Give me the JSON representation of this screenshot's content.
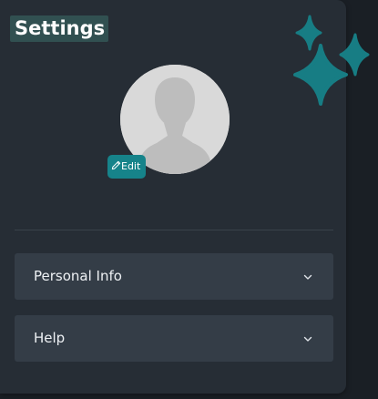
{
  "header": {
    "title": "Settings"
  },
  "profile": {
    "avatar_icon": "default-user-silhouette",
    "edit_label": "Edit",
    "edit_icon": "pencil-icon"
  },
  "sections": [
    {
      "label": "Personal Info",
      "icon": "chevron-down-icon"
    },
    {
      "label": "Help",
      "icon": "chevron-down-icon"
    }
  ],
  "decoration": {
    "icon": "sparkle-stars-icon"
  },
  "colors": {
    "panel_background": "#262d35",
    "title_highlight": "#315051",
    "accent": "#16838a",
    "accordion_background": "#343d47",
    "avatar_background": "#d9d9d9",
    "sparkle": "#177d84"
  }
}
